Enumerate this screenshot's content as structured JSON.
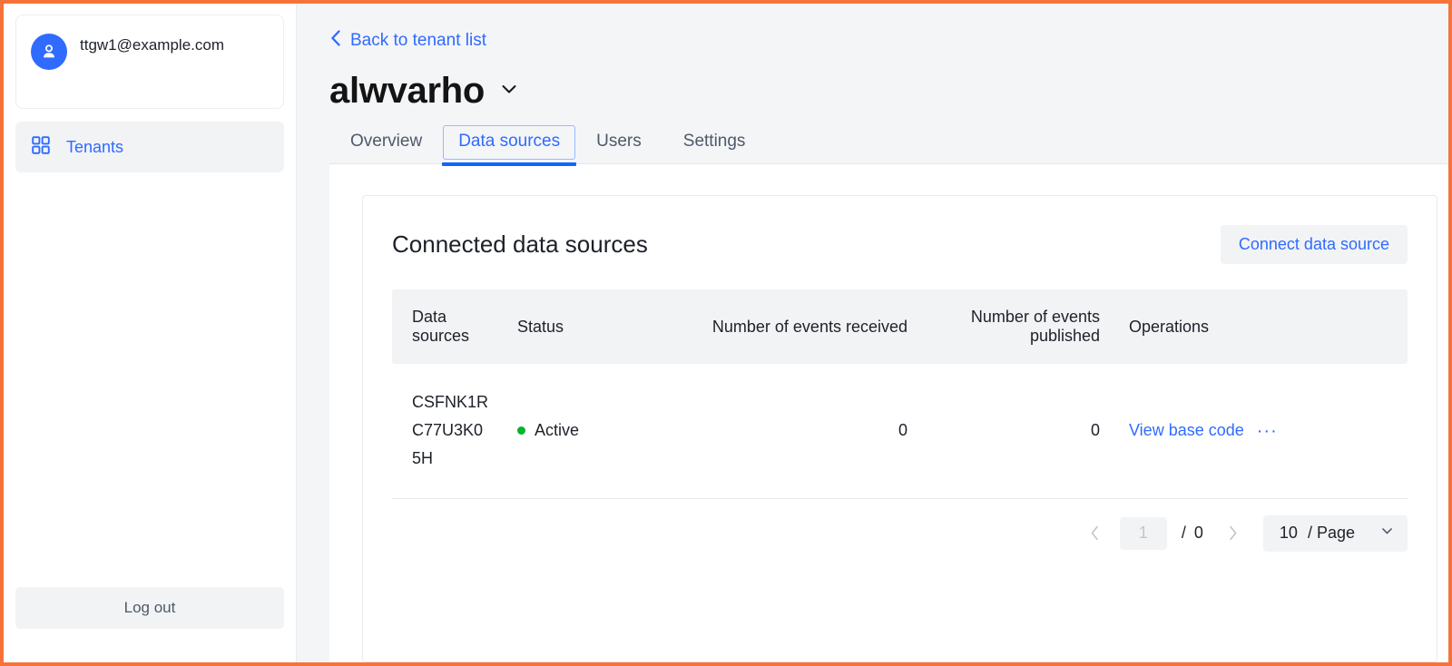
{
  "sidebar": {
    "account": {
      "avatar_icon": "user-avatar-icon",
      "email": "ttgw1@example.com"
    },
    "nav": [
      {
        "icon": "grid-icon",
        "label": "Tenants",
        "active": true
      }
    ],
    "logout_label": "Log out"
  },
  "header": {
    "back_link": "Back to tenant list",
    "back_icon": "chevron-left-icon",
    "tenant_name": "alwvarho",
    "tenant_dropdown_icon": "chevron-down-icon",
    "tabs": [
      {
        "label": "Overview",
        "active": false
      },
      {
        "label": "Data sources",
        "active": true
      },
      {
        "label": "Users",
        "active": false
      },
      {
        "label": "Settings",
        "active": false
      }
    ]
  },
  "card": {
    "title": "Connected data sources",
    "connect_button": "Connect data source"
  },
  "table": {
    "columns": [
      "Data sources",
      "Status",
      "Number of events received",
      "Number of events published",
      "Operations"
    ],
    "rows": [
      {
        "data_source": "CSFNK1RC77U3K05H",
        "status": "Active",
        "status_color": "#00b42a",
        "events_received": "0",
        "events_published": "0",
        "operation_link": "View base code",
        "operation_more": "···"
      }
    ]
  },
  "pagination": {
    "prev_icon": "chevron-left-icon",
    "next_icon": "chevron-right-icon",
    "current_page": "1",
    "separator": "/",
    "total_pages": "0",
    "page_size": "10",
    "page_size_suffix": "/ Page",
    "page_size_chevron": "chevron-down-icon"
  },
  "colors": {
    "accent": "#2f6bff",
    "tab_underline": "#1463ff",
    "status_active": "#00b42a",
    "window_border": "#f5733a",
    "surface": "#f2f3f5",
    "page_bg": "#f4f5f7"
  }
}
